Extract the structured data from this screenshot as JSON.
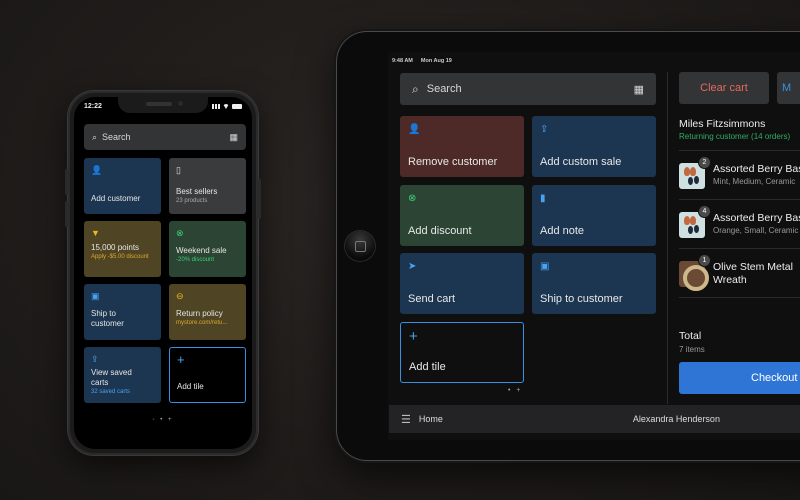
{
  "colors": {
    "tile_blue": "#1c3550",
    "tile_red": "#4d2a27",
    "tile_green": "#2b4433",
    "tile_gray": "#3a3b3c",
    "tile_gold": "#4f4524",
    "accent_blue": "#3b8fe3",
    "checkout_blue": "#2f75d6",
    "clear_red": "#e46a5f",
    "returning_green": "#2fae62"
  },
  "phone": {
    "status": {
      "time": "12:22"
    },
    "search": {
      "placeholder": "Search",
      "search_icon": "⌕",
      "scan_icon": "▦"
    },
    "tiles": [
      {
        "title": "Add customer",
        "subtitle": "",
        "icon": "👤",
        "icon_name": "person-icon",
        "color": "blue"
      },
      {
        "title": "Best sellers",
        "subtitle": "23 products",
        "icon": "▯",
        "icon_name": "product-icon",
        "color": "gray"
      },
      {
        "title": "15,000 points",
        "subtitle": "Apply -$5.00 discount",
        "icon": "▼",
        "icon_name": "rewards-icon",
        "color": "gold"
      },
      {
        "title": "Weekend sale",
        "subtitle": "-20% discount",
        "icon": "⊗",
        "icon_name": "discount-icon",
        "color": "green"
      },
      {
        "title": "Ship to customer",
        "subtitle": "",
        "icon": "▣",
        "icon_name": "shipping-icon",
        "color": "blue"
      },
      {
        "title": "Return policy",
        "subtitle": "mystore.com/retu...",
        "icon": "⊖",
        "icon_name": "link-icon",
        "color": "gold"
      },
      {
        "title": "View saved carts",
        "subtitle": "32 saved carts",
        "icon": "⇪",
        "icon_name": "saved-carts-icon",
        "color": "blue"
      },
      {
        "title": "Add tile",
        "subtitle": "",
        "icon": "+",
        "icon_name": "plus-icon",
        "color": "outline"
      }
    ],
    "page_dots": "◦ • +"
  },
  "tablet": {
    "status": {
      "time": "9:48 AM",
      "date": "Mon Aug 19"
    },
    "search": {
      "placeholder": "Search",
      "search_icon": "⌕",
      "scan_icon": "▦"
    },
    "tiles": [
      {
        "label": "Remove customer",
        "icon": "👤",
        "icon_name": "person-icon",
        "color": "red"
      },
      {
        "label": "Add custom sale",
        "icon": "⇪",
        "icon_name": "custom-sale-icon",
        "color": "blue"
      },
      {
        "label": "Add discount",
        "icon": "⊗",
        "icon_name": "discount-icon",
        "color": "green"
      },
      {
        "label": "Add note",
        "icon": "▮",
        "icon_name": "note-icon",
        "color": "blue"
      },
      {
        "label": "Send cart",
        "icon": "➤",
        "icon_name": "send-icon",
        "color": "blue"
      },
      {
        "label": "Ship to customer",
        "icon": "▣",
        "icon_name": "shipping-icon",
        "color": "blue"
      },
      {
        "label": "Add tile",
        "icon": "+",
        "icon_name": "plus-icon",
        "color": "outline"
      }
    ],
    "page_dots": "• +",
    "cart": {
      "clear_label": "Clear cart",
      "more_label": "M",
      "customer_name": "Miles Fitzsimmons",
      "customer_status": "Returning customer (14 orders)",
      "items": [
        {
          "qty": "2",
          "name": "Assorted Berry Bas",
          "variant": "Mint, Medium, Ceramic",
          "thumb": "berry"
        },
        {
          "qty": "4",
          "name": "Assorted Berry Bas",
          "variant": "Orange, Small, Ceramic",
          "thumb": "berry"
        },
        {
          "qty": "1",
          "name": "Olive Stem Metal Wreath",
          "variant": "",
          "thumb": "wreath"
        }
      ],
      "total_label": "Total",
      "total_items": "7 items",
      "checkout_label": "Checkout"
    },
    "bottom_bar": {
      "menu_icon": "☰",
      "home_label": "Home",
      "user_name": "Alexandra Henderson"
    }
  }
}
